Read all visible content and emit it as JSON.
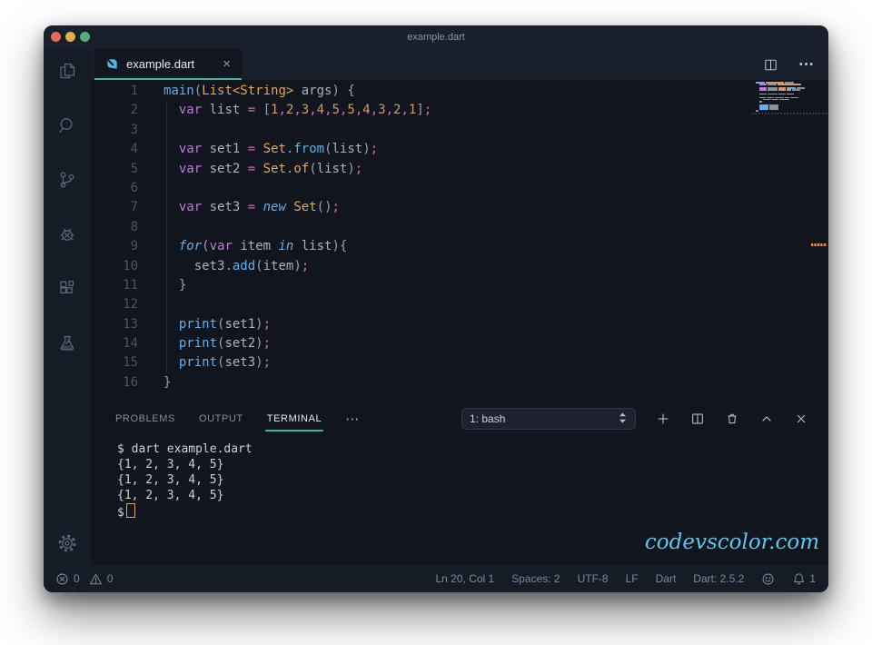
{
  "window": {
    "title": "example.dart"
  },
  "activity_bar": {
    "icons": [
      "explorer",
      "search",
      "source-control",
      "debug",
      "extensions",
      "test"
    ],
    "bottom_icon": "settings-gear"
  },
  "tab_bar": {
    "tab": {
      "icon": "dart-icon",
      "label": "example.dart",
      "close": "×"
    },
    "more": "⋯"
  },
  "editor": {
    "lines": [
      {
        "n": "1",
        "t": [
          [
            "main",
            "fn"
          ],
          [
            "(",
            "pl"
          ],
          [
            "List<String>",
            "ty"
          ],
          [
            " args",
            "tx"
          ],
          [
            ") {",
            "pl"
          ]
        ]
      },
      {
        "n": "2",
        "t": [
          [
            "  ",
            "tx"
          ],
          [
            "var",
            "kw"
          ],
          [
            " list ",
            "tx"
          ],
          [
            "=",
            "op"
          ],
          [
            " ",
            "tx"
          ],
          [
            "[",
            "pl"
          ],
          [
            "1",
            "num"
          ],
          [
            ",",
            "op"
          ],
          [
            "2",
            "num"
          ],
          [
            ",",
            "op"
          ],
          [
            "3",
            "num"
          ],
          [
            ",",
            "op"
          ],
          [
            "4",
            "num"
          ],
          [
            ",",
            "op"
          ],
          [
            "5",
            "num"
          ],
          [
            ",",
            "op"
          ],
          [
            "5",
            "num"
          ],
          [
            ",",
            "op"
          ],
          [
            "4",
            "num"
          ],
          [
            ",",
            "op"
          ],
          [
            "3",
            "num"
          ],
          [
            ",",
            "op"
          ],
          [
            "2",
            "num"
          ],
          [
            ",",
            "op"
          ],
          [
            "1",
            "num"
          ],
          [
            "]",
            "pl"
          ],
          [
            ";",
            "op"
          ]
        ]
      },
      {
        "n": "3",
        "t": []
      },
      {
        "n": "4",
        "t": [
          [
            "  ",
            "tx"
          ],
          [
            "var",
            "kw"
          ],
          [
            " set1 ",
            "tx"
          ],
          [
            "=",
            "op"
          ],
          [
            " ",
            "tx"
          ],
          [
            "Set",
            "ty"
          ],
          [
            ".",
            "pl"
          ],
          [
            "from",
            "fn"
          ],
          [
            "(",
            "pl"
          ],
          [
            "list",
            "tx"
          ],
          [
            ")",
            "pl"
          ],
          [
            ";",
            "op"
          ]
        ]
      },
      {
        "n": "5",
        "t": [
          [
            "  ",
            "tx"
          ],
          [
            "var",
            "kw"
          ],
          [
            " set2 ",
            "tx"
          ],
          [
            "=",
            "op"
          ],
          [
            " ",
            "tx"
          ],
          [
            "Set",
            "ty"
          ],
          [
            ".",
            "pl"
          ],
          [
            "of",
            "ty"
          ],
          [
            "(",
            "pl"
          ],
          [
            "list",
            "tx"
          ],
          [
            ")",
            "pl"
          ],
          [
            ";",
            "op"
          ]
        ]
      },
      {
        "n": "6",
        "t": []
      },
      {
        "n": "7",
        "t": [
          [
            "  ",
            "tx"
          ],
          [
            "var",
            "kw"
          ],
          [
            " set3 ",
            "tx"
          ],
          [
            "=",
            "op"
          ],
          [
            " ",
            "tx"
          ],
          [
            "new",
            "kwi"
          ],
          [
            " ",
            "tx"
          ],
          [
            "Set",
            "ty"
          ],
          [
            "()",
            "pl"
          ],
          [
            ";",
            "op"
          ]
        ]
      },
      {
        "n": "8",
        "t": []
      },
      {
        "n": "9",
        "t": [
          [
            "  ",
            "tx"
          ],
          [
            "for",
            "kwi"
          ],
          [
            "(",
            "pl"
          ],
          [
            "var",
            "kw"
          ],
          [
            " item ",
            "tx"
          ],
          [
            "in",
            "kwi"
          ],
          [
            " list",
            "tx"
          ],
          [
            "){",
            "pl"
          ]
        ]
      },
      {
        "n": "10",
        "t": [
          [
            "    set3",
            "tx"
          ],
          [
            ".",
            "pl"
          ],
          [
            "add",
            "fn"
          ],
          [
            "(",
            "pl"
          ],
          [
            "item",
            "tx"
          ],
          [
            ")",
            "pl"
          ],
          [
            ";",
            "op"
          ]
        ]
      },
      {
        "n": "11",
        "t": [
          [
            "  }",
            "pl"
          ]
        ]
      },
      {
        "n": "12",
        "t": []
      },
      {
        "n": "13",
        "t": [
          [
            "  ",
            "tx"
          ],
          [
            "print",
            "fn"
          ],
          [
            "(",
            "pl"
          ],
          [
            "set1",
            "tx"
          ],
          [
            ")",
            "pl"
          ],
          [
            ";",
            "op"
          ]
        ]
      },
      {
        "n": "14",
        "t": [
          [
            "  ",
            "tx"
          ],
          [
            "print",
            "fn"
          ],
          [
            "(",
            "pl"
          ],
          [
            "set2",
            "tx"
          ],
          [
            ")",
            "pl"
          ],
          [
            ";",
            "op"
          ]
        ]
      },
      {
        "n": "15",
        "t": [
          [
            "  ",
            "tx"
          ],
          [
            "print",
            "fn"
          ],
          [
            "(",
            "pl"
          ],
          [
            "set3",
            "tx"
          ],
          [
            ")",
            "pl"
          ],
          [
            ";",
            "op"
          ]
        ]
      },
      {
        "n": "16",
        "t": [
          [
            "}",
            "pl"
          ]
        ]
      }
    ]
  },
  "minimap": {
    "rows": [
      {
        "i": 0,
        "s": [
          [
            10,
            "fn"
          ],
          [
            20,
            "ty"
          ],
          [
            10,
            "tx"
          ]
        ]
      },
      {
        "i": 4,
        "s": [
          [
            8,
            "kw"
          ],
          [
            10,
            "tx"
          ],
          [
            26,
            "num"
          ]
        ]
      },
      {
        "i": 0,
        "s": []
      },
      {
        "i": 4,
        "s": [
          [
            8,
            "kw"
          ],
          [
            11,
            "tx"
          ],
          [
            8,
            "ty"
          ],
          [
            10,
            "fn"
          ],
          [
            9,
            "tx"
          ]
        ]
      },
      {
        "i": 4,
        "s": [
          [
            8,
            "kw"
          ],
          [
            11,
            "tx"
          ],
          [
            8,
            "ty"
          ],
          [
            5,
            "ty"
          ],
          [
            9,
            "tx"
          ]
        ]
      },
      {
        "i": 0,
        "s": []
      },
      {
        "i": 4,
        "s": [
          [
            8,
            "kw"
          ],
          [
            11,
            "tx"
          ],
          [
            8,
            "fn"
          ],
          [
            8,
            "ty"
          ]
        ]
      },
      {
        "i": 0,
        "s": []
      },
      {
        "i": 4,
        "s": [
          [
            7,
            "fn"
          ],
          [
            8,
            "kw"
          ],
          [
            10,
            "tx"
          ],
          [
            5,
            "fn"
          ],
          [
            9,
            "tx"
          ]
        ]
      },
      {
        "i": 8,
        "s": [
          [
            9,
            "tx"
          ],
          [
            7,
            "fn"
          ],
          [
            11,
            "tx"
          ]
        ]
      },
      {
        "i": 4,
        "s": [
          [
            3,
            "tx"
          ]
        ]
      },
      {
        "i": 0,
        "s": []
      },
      {
        "i": 4,
        "s": [
          [
            10,
            "fn"
          ],
          [
            10,
            "tx"
          ]
        ]
      },
      {
        "i": 4,
        "s": [
          [
            10,
            "fn"
          ],
          [
            10,
            "tx"
          ]
        ]
      },
      {
        "i": 4,
        "s": [
          [
            10,
            "fn"
          ],
          [
            10,
            "tx"
          ]
        ]
      },
      {
        "i": 0,
        "s": [
          [
            3,
            "tx"
          ]
        ]
      }
    ]
  },
  "panel": {
    "tabs": [
      {
        "label": "PROBLEMS",
        "active": false
      },
      {
        "label": "OUTPUT",
        "active": false
      },
      {
        "label": "TERMINAL",
        "active": true
      }
    ],
    "more": "⋯",
    "select_value": "1: bash",
    "terminal": {
      "lines": [
        "$ dart example.dart",
        "{1, 2, 3, 4, 5}",
        "{1, 2, 3, 4, 5}",
        "{1, 2, 3, 4, 5}"
      ],
      "prompt": "$"
    }
  },
  "watermark": "codevscolor.com",
  "status_bar": {
    "errors": "0",
    "warnings": "0",
    "right": [
      "Ln 20, Col 1",
      "Spaces: 2",
      "UTF-8",
      "LF",
      "Dart",
      "Dart: 2.5.2"
    ],
    "bell_count": "1"
  },
  "colors": {
    "accent_teal": "#3fb79c",
    "watermark_blue": "#5fc6f2",
    "cursor_orange": "#dca85e",
    "ruler_marker_orange": "#e09142"
  }
}
